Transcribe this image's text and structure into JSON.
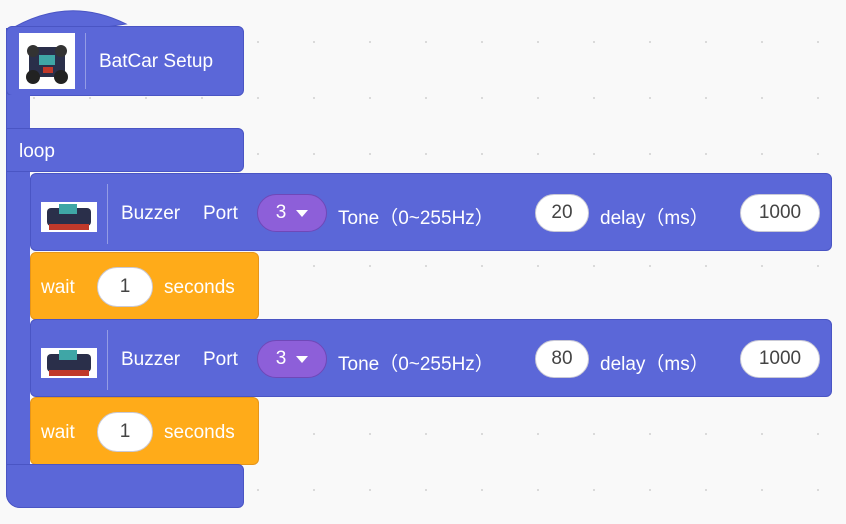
{
  "setup": {
    "label": "BatCar Setup",
    "icon": "robot-car-icon"
  },
  "loop": {
    "label": "loop"
  },
  "blocks": [
    {
      "type": "buzzer",
      "label_buzzer": "Buzzer",
      "label_port": "Port",
      "port": "3",
      "label_tone": "Tone（0~255Hz）",
      "tone": "20",
      "label_delay": "delay（ms）",
      "delay": "1000"
    },
    {
      "type": "wait",
      "label_wait": "wait",
      "value": "1",
      "label_unit": "seconds"
    },
    {
      "type": "buzzer",
      "label_buzzer": "Buzzer",
      "label_port": "Port",
      "port": "3",
      "label_tone": "Tone（0~255Hz）",
      "tone": "80",
      "label_delay": "delay（ms）",
      "delay": "1000"
    },
    {
      "type": "wait",
      "label_wait": "wait",
      "value": "1",
      "label_unit": "seconds"
    }
  ],
  "colors": {
    "motion_blue": "#5b67d8",
    "control_orange": "#ffab19",
    "dropdown_purple": "#8d5fd9"
  }
}
